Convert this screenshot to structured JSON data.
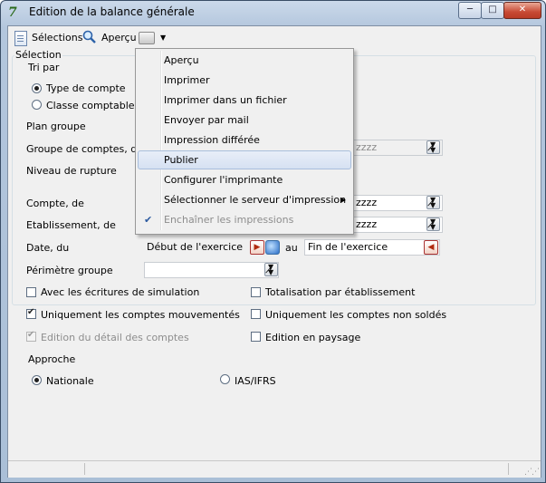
{
  "window": {
    "title": "Edition de la balance générale",
    "minimize": "─",
    "maximize": "□",
    "close": "✕"
  },
  "toolbar": {
    "selections": "Sélections",
    "apercu": "Aperçu"
  },
  "selection_group": {
    "title": "Sélection",
    "tri_par": "Tri par",
    "tri_options": [
      {
        "label": "Type de compte",
        "selected": true
      },
      {
        "label": "Classe comptable",
        "selected": false
      }
    ],
    "plan_groupe": "Plan groupe",
    "groupe_comptes": {
      "label": "Groupe de comptes, de",
      "to_value": "zzzz"
    },
    "niveau_rupture": "Niveau de rupture",
    "compte": {
      "label": "Compte, de",
      "to_value": "zzzz"
    },
    "etablissement": {
      "label": "Etablissement, de",
      "to_value": "zzzz"
    },
    "date": {
      "label": "Date, du",
      "from": "Début de l'exercice",
      "au": "au",
      "to": "Fin de l'exercice"
    },
    "perimetre": {
      "label": "Périmètre groupe",
      "value": ""
    }
  },
  "checkboxes": [
    {
      "label": "Avec les écritures de simulation",
      "checked": false,
      "disabled": false
    },
    {
      "label": "Totalisation par établissement",
      "checked": false,
      "disabled": false
    },
    {
      "label": "Uniquement les comptes mouvementés",
      "checked": true,
      "disabled": false
    },
    {
      "label": "Uniquement les comptes non soldés",
      "checked": false,
      "disabled": false
    },
    {
      "label": "Edition du détail des comptes",
      "checked": true,
      "disabled": true
    },
    {
      "label": "Edition en paysage",
      "checked": false,
      "disabled": false
    }
  ],
  "approche": {
    "label": "Approche",
    "options": [
      {
        "label": "Nationale",
        "selected": true
      },
      {
        "label": "IAS/IFRS",
        "selected": false
      }
    ]
  },
  "menu": {
    "items": [
      {
        "label": "Aperçu",
        "state": "normal"
      },
      {
        "label": "Imprimer",
        "state": "normal"
      },
      {
        "label": "Imprimer dans un fichier",
        "state": "normal"
      },
      {
        "label": "Envoyer par mail",
        "state": "normal"
      },
      {
        "label": "Impression différée",
        "state": "normal"
      },
      {
        "label": "Publier",
        "state": "highlighted"
      },
      {
        "label": "Configurer l'imprimante",
        "state": "normal"
      },
      {
        "label": "Sélectionner le serveur d'impression",
        "state": "submenu"
      },
      {
        "label": "Enchaîner les impressions",
        "state": "disabled-checked"
      }
    ]
  }
}
